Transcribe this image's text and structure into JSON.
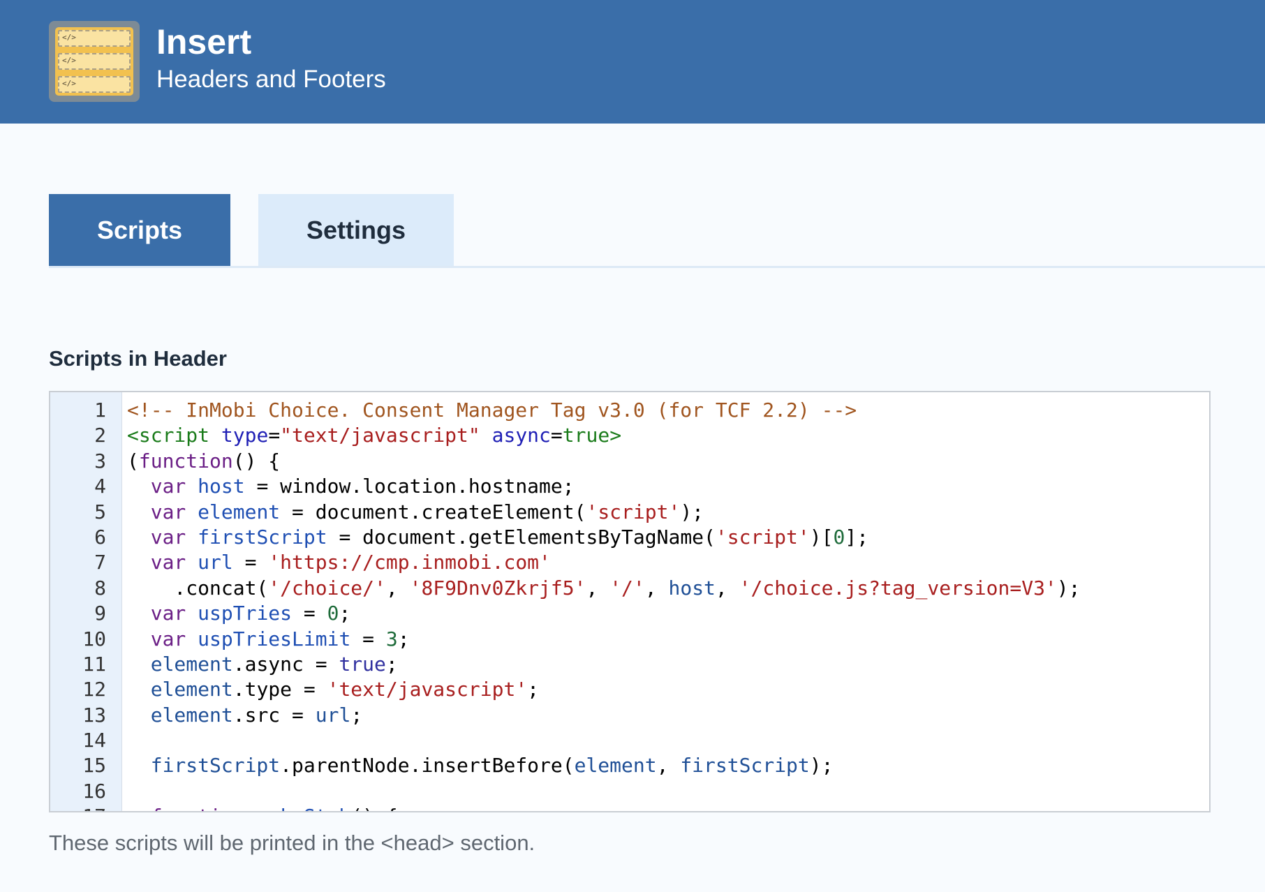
{
  "header": {
    "title": "Insert",
    "subtitle": "Headers and Footers",
    "logo_icon": "code-blocks-icon",
    "logo_glyph": "</>"
  },
  "tabs": [
    {
      "label": "Scripts",
      "active": true
    },
    {
      "label": "Settings",
      "active": false
    }
  ],
  "section": {
    "title": "Scripts in Header",
    "helper_text": "These scripts will be printed in the <head> section."
  },
  "editor": {
    "lines": [
      [
        [
          "comment",
          "<!-- InMobi Choice. Consent Manager Tag v3.0 (for TCF 2.2) -->"
        ]
      ],
      [
        [
          "tag",
          "<script"
        ],
        [
          "plain",
          " "
        ],
        [
          "attr",
          "type"
        ],
        [
          "plain",
          "="
        ],
        [
          "str",
          "\"text/javascript\""
        ],
        [
          "plain",
          " "
        ],
        [
          "attr",
          "async"
        ],
        [
          "plain",
          "="
        ],
        [
          "tag",
          "true>"
        ]
      ],
      [
        [
          "plain",
          "("
        ],
        [
          "kw",
          "function"
        ],
        [
          "plain",
          "() {"
        ]
      ],
      [
        [
          "plain",
          "  "
        ],
        [
          "kw",
          "var"
        ],
        [
          "plain",
          " "
        ],
        [
          "def",
          "host"
        ],
        [
          "plain",
          " = window.location.hostname;"
        ]
      ],
      [
        [
          "plain",
          "  "
        ],
        [
          "kw",
          "var"
        ],
        [
          "plain",
          " "
        ],
        [
          "def",
          "element"
        ],
        [
          "plain",
          " = document.createElement("
        ],
        [
          "str",
          "'script'"
        ],
        [
          "plain",
          ");"
        ]
      ],
      [
        [
          "plain",
          "  "
        ],
        [
          "kw",
          "var"
        ],
        [
          "plain",
          " "
        ],
        [
          "def",
          "firstScript"
        ],
        [
          "plain",
          " = document.getElementsByTagName("
        ],
        [
          "str",
          "'script'"
        ],
        [
          "plain",
          ")["
        ],
        [
          "num",
          "0"
        ],
        [
          "plain",
          "];"
        ]
      ],
      [
        [
          "plain",
          "  "
        ],
        [
          "kw",
          "var"
        ],
        [
          "plain",
          " "
        ],
        [
          "def",
          "url"
        ],
        [
          "plain",
          " = "
        ],
        [
          "str",
          "'https://cmp.inmobi.com'"
        ]
      ],
      [
        [
          "plain",
          "    .concat("
        ],
        [
          "str",
          "'/choice/'"
        ],
        [
          "plain",
          ", "
        ],
        [
          "str",
          "'8F9Dnv0Zkrjf5'"
        ],
        [
          "plain",
          ", "
        ],
        [
          "str",
          "'/'"
        ],
        [
          "plain",
          ", "
        ],
        [
          "var",
          "host"
        ],
        [
          "plain",
          ", "
        ],
        [
          "str",
          "'/choice.js?tag_version=V3'"
        ],
        [
          "plain",
          ");"
        ]
      ],
      [
        [
          "plain",
          "  "
        ],
        [
          "kw",
          "var"
        ],
        [
          "plain",
          " "
        ],
        [
          "def",
          "uspTries"
        ],
        [
          "plain",
          " = "
        ],
        [
          "num",
          "0"
        ],
        [
          "plain",
          ";"
        ]
      ],
      [
        [
          "plain",
          "  "
        ],
        [
          "kw",
          "var"
        ],
        [
          "plain",
          " "
        ],
        [
          "def",
          "uspTriesLimit"
        ],
        [
          "plain",
          " = "
        ],
        [
          "num",
          "3"
        ],
        [
          "plain",
          ";"
        ]
      ],
      [
        [
          "plain",
          "  "
        ],
        [
          "var",
          "element"
        ],
        [
          "plain",
          ".async = "
        ],
        [
          "atom",
          "true"
        ],
        [
          "plain",
          ";"
        ]
      ],
      [
        [
          "plain",
          "  "
        ],
        [
          "var",
          "element"
        ],
        [
          "plain",
          ".type = "
        ],
        [
          "str",
          "'text/javascript'"
        ],
        [
          "plain",
          ";"
        ]
      ],
      [
        [
          "plain",
          "  "
        ],
        [
          "var",
          "element"
        ],
        [
          "plain",
          ".src = "
        ],
        [
          "var",
          "url"
        ],
        [
          "plain",
          ";"
        ]
      ],
      [
        [
          "plain",
          ""
        ]
      ],
      [
        [
          "plain",
          "  "
        ],
        [
          "var",
          "firstScript"
        ],
        [
          "plain",
          ".parentNode.insertBefore("
        ],
        [
          "var",
          "element"
        ],
        [
          "plain",
          ", "
        ],
        [
          "var",
          "firstScript"
        ],
        [
          "plain",
          ");"
        ]
      ],
      [
        [
          "plain",
          ""
        ]
      ],
      [
        [
          "plain",
          "  "
        ],
        [
          "kw",
          "function"
        ],
        [
          "plain",
          " "
        ],
        [
          "def",
          "makeStub"
        ],
        [
          "plain",
          "() {"
        ]
      ]
    ]
  }
}
